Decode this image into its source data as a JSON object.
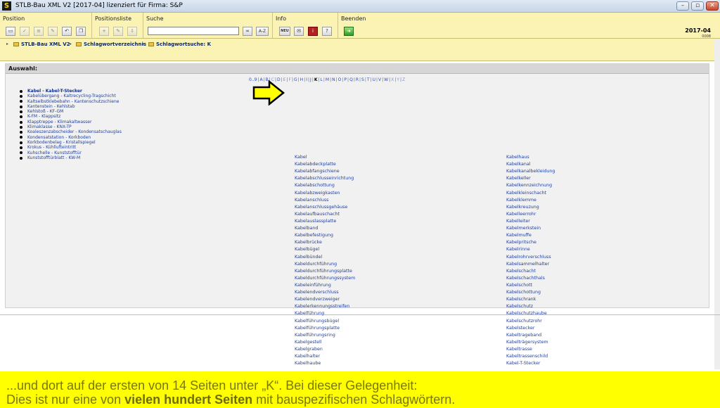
{
  "window": {
    "title": "STLB-Bau XML V2 [2017-04] lizenziert für Firma: S&P",
    "app_icon_letter": "S",
    "controls": [
      "–",
      "▫",
      "✕"
    ]
  },
  "toolbar": {
    "groups": [
      {
        "label": "Position"
      },
      {
        "label": "Positionsliste"
      },
      {
        "label": "Suche"
      },
      {
        "label": "Info"
      },
      {
        "label": "Beenden"
      }
    ],
    "search": {
      "value": "",
      "placeholder": ""
    },
    "search_button_label": "A-Z",
    "info_new_label": "NEU",
    "version_top": "2017-04",
    "version_sub": "0008"
  },
  "breadcrumb": {
    "items": [
      "STLB-Bau XML V2",
      "Schlagwortverzeichnis",
      "Schlagwortsuche: K"
    ]
  },
  "panel": {
    "header": "Auswahl:",
    "letters": [
      "0..9",
      "A",
      "B",
      "C",
      "D",
      "E",
      "F",
      "G",
      "H",
      "I",
      "J",
      "K",
      "L",
      "M",
      "N",
      "O",
      "P",
      "Q",
      "R",
      "S",
      "T",
      "U",
      "V",
      "W",
      "X",
      "Y",
      "Z"
    ],
    "active_letter": "K",
    "recent_list": [
      "Kabel - Kabel-T-Stecker",
      "Kabelübergang - Kaltrecycling-Tragschicht",
      "Kaltselbstklebebahn - Kantenschutzschiene",
      "Kantenstein - Kehlstab",
      "Kehlstoß - KF-GM",
      "K-FM - Klappsitz",
      "Klapptreppe - Klimakaltwasser",
      "Klimaklasse - KNX-TP",
      "Koaleszenzabscheider - Kondensatschauglas",
      "Kondensatstation - Korkboden",
      "Korkbodenbelag - Kristallspiegel",
      "Krokus - Kühllufteintritt",
      "Kuhschelle - Kunststofftür",
      "Kunststofftürblatt - KW-M"
    ],
    "keywords_col1": [
      "Kabel",
      "Kabelabdeckplatte",
      "Kabelabfangschiene",
      "Kabelabschlusseinrichtung",
      "Kabelabschottung",
      "Kabelabzweigkasten",
      "Kabelanschluss",
      "Kabelanschlussgehäuse",
      "Kabelaufbauschacht",
      "Kabelauslassplatte",
      "Kabelband",
      "Kabelbefestigung",
      "Kabelbrücke",
      "Kabelbügel",
      "Kabelbündel",
      "Kabeldurchführung",
      "Kabeldurchführungsplatte",
      "Kabeldurchführungssystem",
      "Kabeleinführung",
      "Kabelendverschluss",
      "Kabelendverzweiger",
      "Kabelerkennungsstreifen",
      "Kabelführung",
      "Kabelführungsbügel",
      "Kabelführungsplatte",
      "Kabelführungsring",
      "Kabelgestell",
      "Kabelgraben",
      "Kabelhalter",
      "Kabelhaube"
    ],
    "keywords_col2": [
      "Kabelhaus",
      "Kabelkanal",
      "Kabelkanalbekleidung",
      "Kabelkeller",
      "Kabelkennzeichnung",
      "Kabelkleinschacht",
      "Kabelklemme",
      "Kabelkreuzung",
      "Kabelleerrohr",
      "Kabelleiter",
      "Kabelmerkstein",
      "Kabelmuffe",
      "Kabelpritsche",
      "Kabelrinne",
      "Kabelrohrverschluss",
      "Kabelsammelhalter",
      "Kabelschacht",
      "Kabelschachthals",
      "Kabelschott",
      "Kabelschottung",
      "Kabelschrank",
      "Kabelschutz",
      "Kabelschutzhaube",
      "Kabelschutzrohr",
      "Kabelstecker",
      "Kabeltrageband",
      "Kabelträgersystem",
      "Kabeltrasse",
      "Kabeltrassenschild",
      "Kabel-T-Stecker"
    ]
  },
  "caption": {
    "line1": "...und dort auf der ersten von 14 Seiten unter „K“. Bei dieser Gelegenheit:",
    "line2_before": "Dies ist nur eine von ",
    "line2_bold": "vielen hundert Seiten",
    "line2_after": " mit bauspezifischen Schlagwörtern."
  },
  "colors": {
    "toolbar_bg": "#fbf3b4",
    "caption_bg": "#ffff00",
    "link": "#1f3f9f",
    "pointer_arrow": "#ffff00"
  }
}
